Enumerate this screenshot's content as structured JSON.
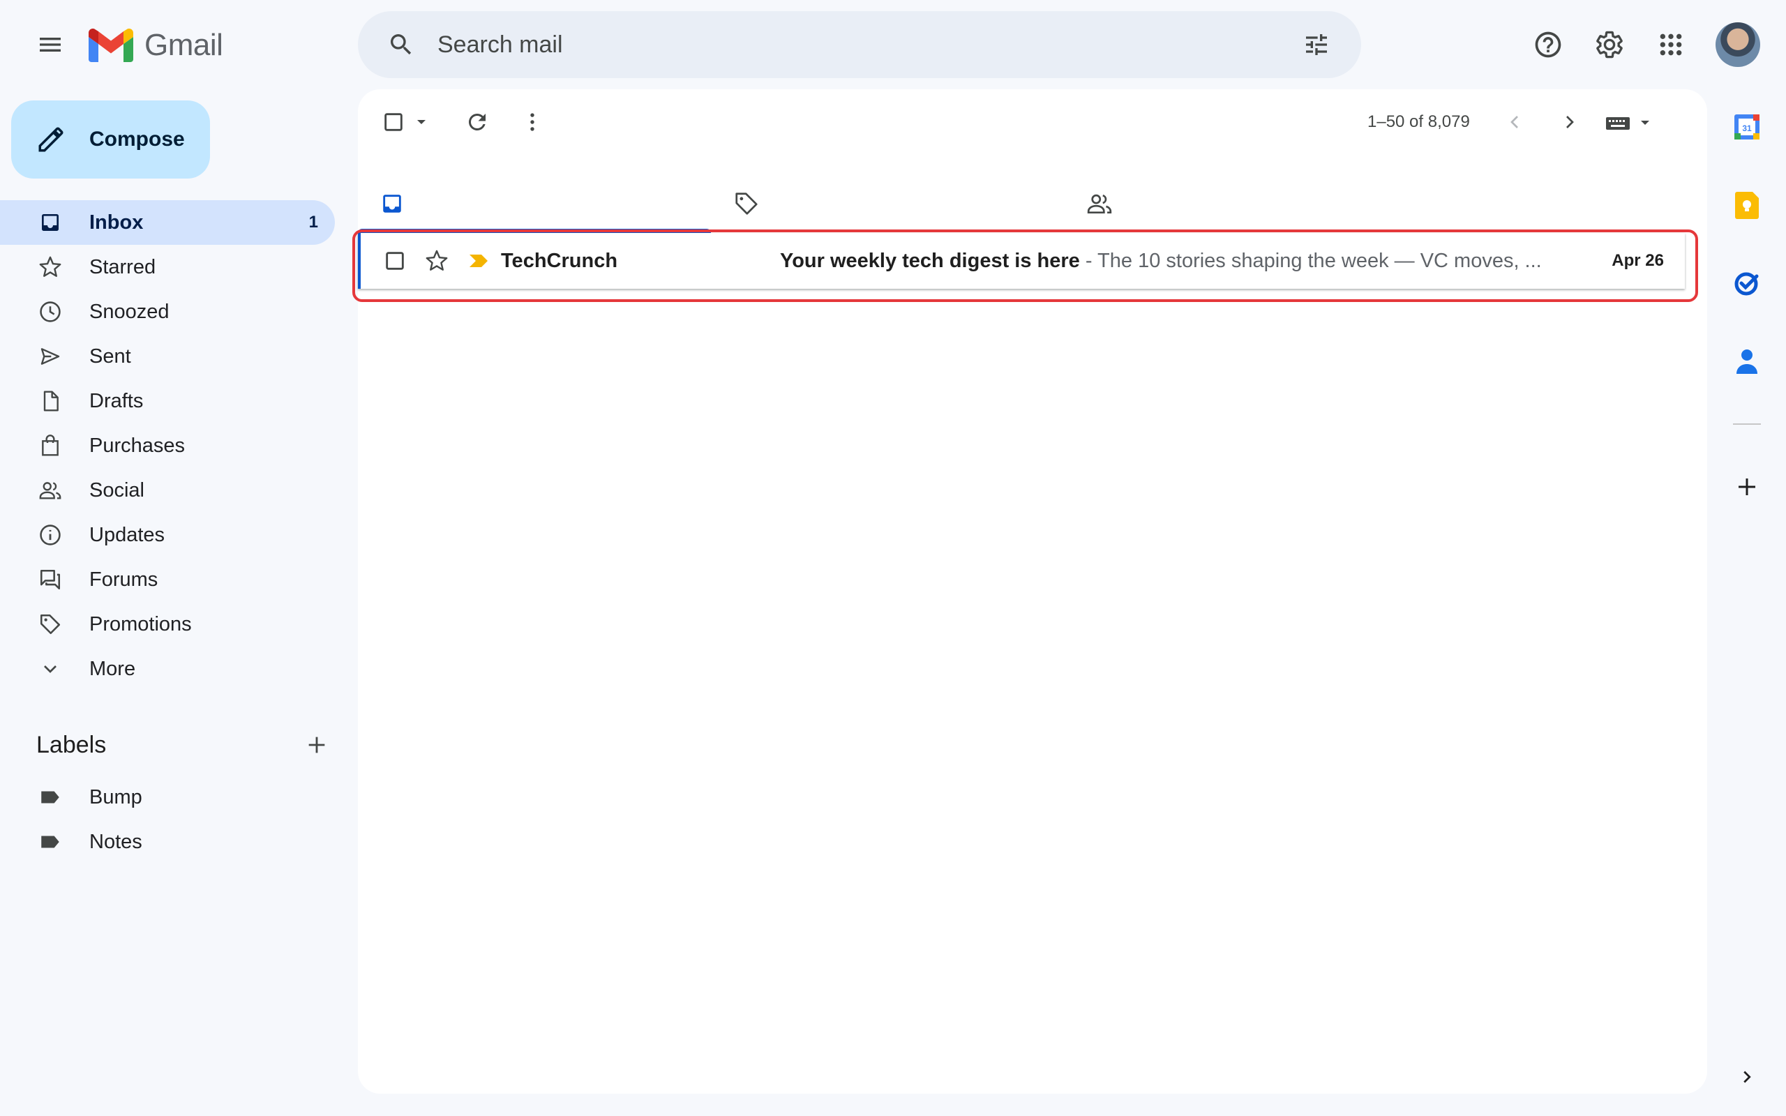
{
  "app": {
    "name": "Gmail"
  },
  "search": {
    "placeholder": "Search mail"
  },
  "compose": {
    "label": "Compose"
  },
  "nav": {
    "items": [
      {
        "label": "Inbox",
        "count": "1",
        "icon": "inbox-icon"
      },
      {
        "label": "Starred",
        "icon": "star-icon"
      },
      {
        "label": "Snoozed",
        "icon": "clock-icon"
      },
      {
        "label": "Sent",
        "icon": "send-icon"
      },
      {
        "label": "Drafts",
        "icon": "draft-icon"
      },
      {
        "label": "Purchases",
        "icon": "shopping-bag-icon"
      },
      {
        "label": "Social",
        "icon": "people-icon"
      },
      {
        "label": "Updates",
        "icon": "info-icon"
      },
      {
        "label": "Forums",
        "icon": "forum-icon"
      },
      {
        "label": "Promotions",
        "icon": "tag-icon"
      },
      {
        "label": "More",
        "icon": "chevron-down-icon"
      }
    ]
  },
  "labels": {
    "title": "Labels",
    "items": [
      {
        "label": "Bump"
      },
      {
        "label": "Notes"
      }
    ]
  },
  "toolbar": {
    "pagination": "1–50 of 8,079"
  },
  "tabs": [
    {
      "icon": "inbox-icon",
      "active": true
    },
    {
      "icon": "tag-icon",
      "active": false
    },
    {
      "icon": "people-icon",
      "active": false
    }
  ],
  "emails": [
    {
      "sender": "TechCrunch",
      "subject": "Your weekly tech digest is here",
      "separator": " - ",
      "snippet": "The 10 stories shaping the week — VC moves, ...",
      "date": "Apr 26",
      "unread": true,
      "important": true
    }
  ],
  "colors": {
    "background": "#f6f8fc",
    "compose": "#c2e7ff",
    "active_nav": "#d3e3fd",
    "accent": "#0b57d0",
    "highlight": "#e5383b"
  }
}
